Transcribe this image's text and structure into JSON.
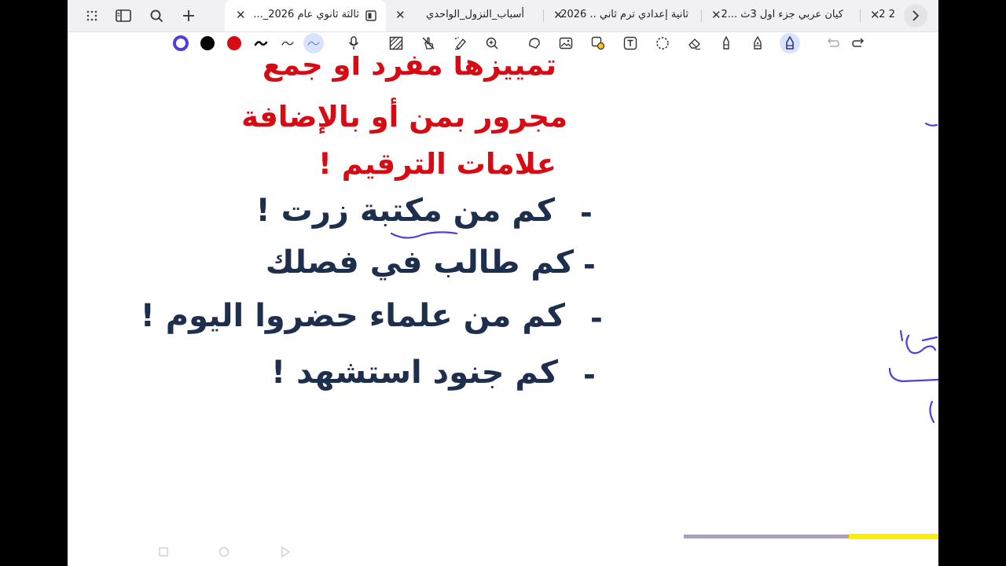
{
  "tabs": [
    {
      "label": "ثالثة ثانوي عام 2026_...",
      "active": true
    },
    {
      "label": "أسباب_النزول_الواحدي",
      "active": false
    },
    {
      "label": "ثانية إعدادي ترم ثاني .. 2026",
      "active": false
    },
    {
      "label": "كيان عربي جزء اول 3ث ...2",
      "active": false
    },
    {
      "label": "2 2",
      "active": false
    }
  ],
  "tab_close_glyph": "✕",
  "toolbar": {
    "colors": [
      "#4b3fe0",
      "#000000",
      "#d60b14"
    ]
  },
  "content": {
    "red_lines": [
      "تمييزها مفرد أو جمع",
      "مجرور بمن أو بالإضافة",
      "علامات الترقيم !"
    ],
    "examples": [
      {
        "dash": "-",
        "text": "كم من مكتبة زرت !"
      },
      {
        "dash": "-",
        "text": "كم طالب في فصلك"
      },
      {
        "dash": "-",
        "text": "كم من علماء حضروا اليوم !"
      },
      {
        "dash": "-",
        "text": "كم جنود استشهد !"
      }
    ]
  },
  "accent_colors": {
    "red": "#d60b14",
    "navy": "#1e2f4d",
    "ink": "#4b3fe0"
  }
}
